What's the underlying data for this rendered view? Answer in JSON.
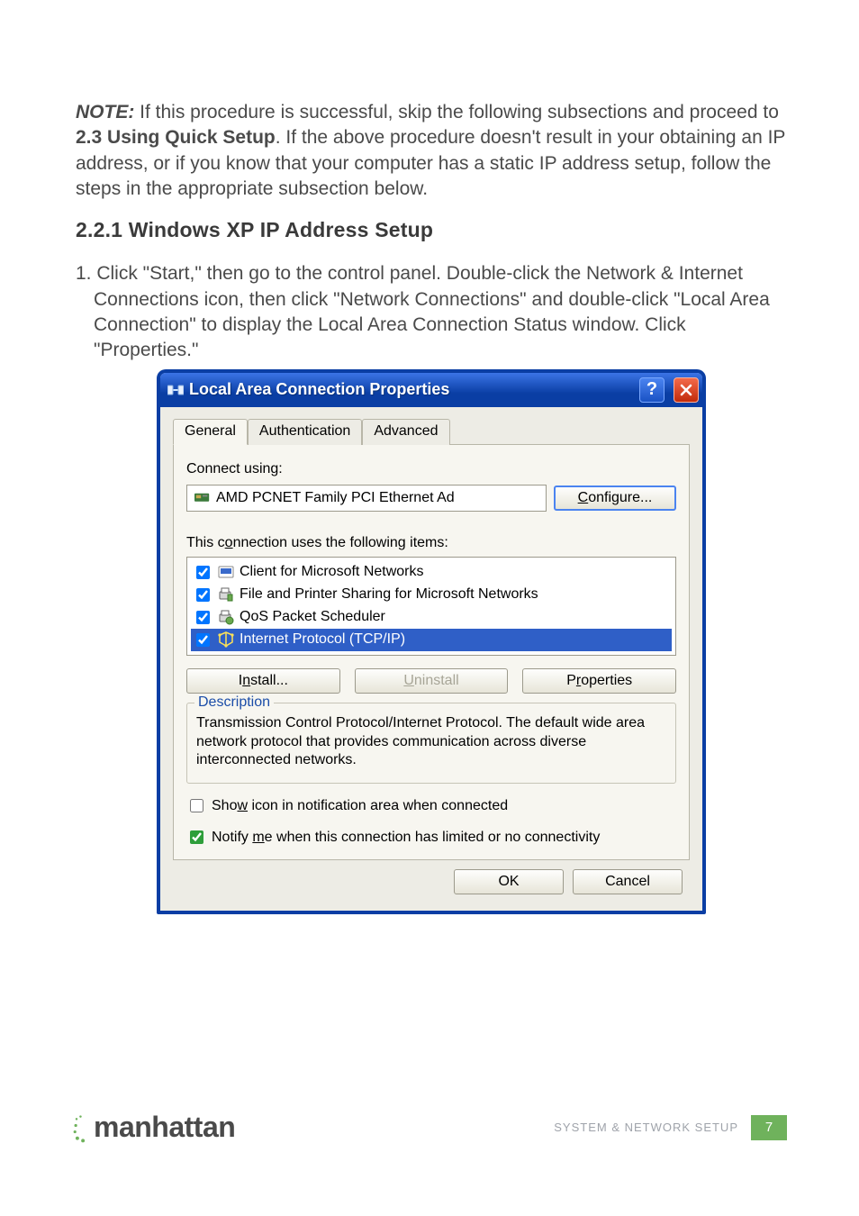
{
  "intro": {
    "note_label": "NOTE:",
    "before_bold": " If this procedure is successful, skip the following subsections and proceed to ",
    "bold_ref": "2.3 Using Quick Setup",
    "after_bold": ". If the above procedure doesn't result in your obtaining an IP address, or if you know that your computer has a static IP address setup, follow the steps in the appropriate subsection below."
  },
  "heading": "2.2.1  Windows XP IP Address Setup",
  "step1": "1. Click \"Start,\" then go to the control panel. Double-click the Network & Internet Connections icon, then click \"Network Connections\" and double-click \"Local Area Connection\" to display the Local Area Connection Status window. Click \"Properties.\"",
  "dialog": {
    "title": "Local Area Connection Properties",
    "tabs": {
      "general": "General",
      "auth": "Authentication",
      "adv": "Advanced"
    },
    "connect_using_label": "Connect using:",
    "adapter": "AMD PCNET Family PCI Ethernet Ad",
    "configure_btn": "Configure...",
    "items_label": "This connection uses the following items:",
    "items": [
      {
        "label": "Client for Microsoft Networks"
      },
      {
        "label": "File and Printer Sharing for Microsoft Networks"
      },
      {
        "label": "QoS Packet Scheduler"
      },
      {
        "label": "Internet Protocol (TCP/IP)"
      }
    ],
    "install_btn": "Install...",
    "uninstall_btn": "Uninstall",
    "properties_btn": "Properties",
    "description_group": "Description",
    "description_text": "Transmission Control Protocol/Internet Protocol. The default wide area network protocol that provides communication across diverse interconnected networks.",
    "show_icon_cb": "Show icon in notification area when connected",
    "notify_cb": "Notify me when this connection has limited or no connectivity",
    "ok_btn": "OK",
    "cancel_btn": "Cancel"
  },
  "footer": {
    "brand": "manhattan",
    "section": "SYSTEM & NETWORK SETUP",
    "page": "7"
  }
}
